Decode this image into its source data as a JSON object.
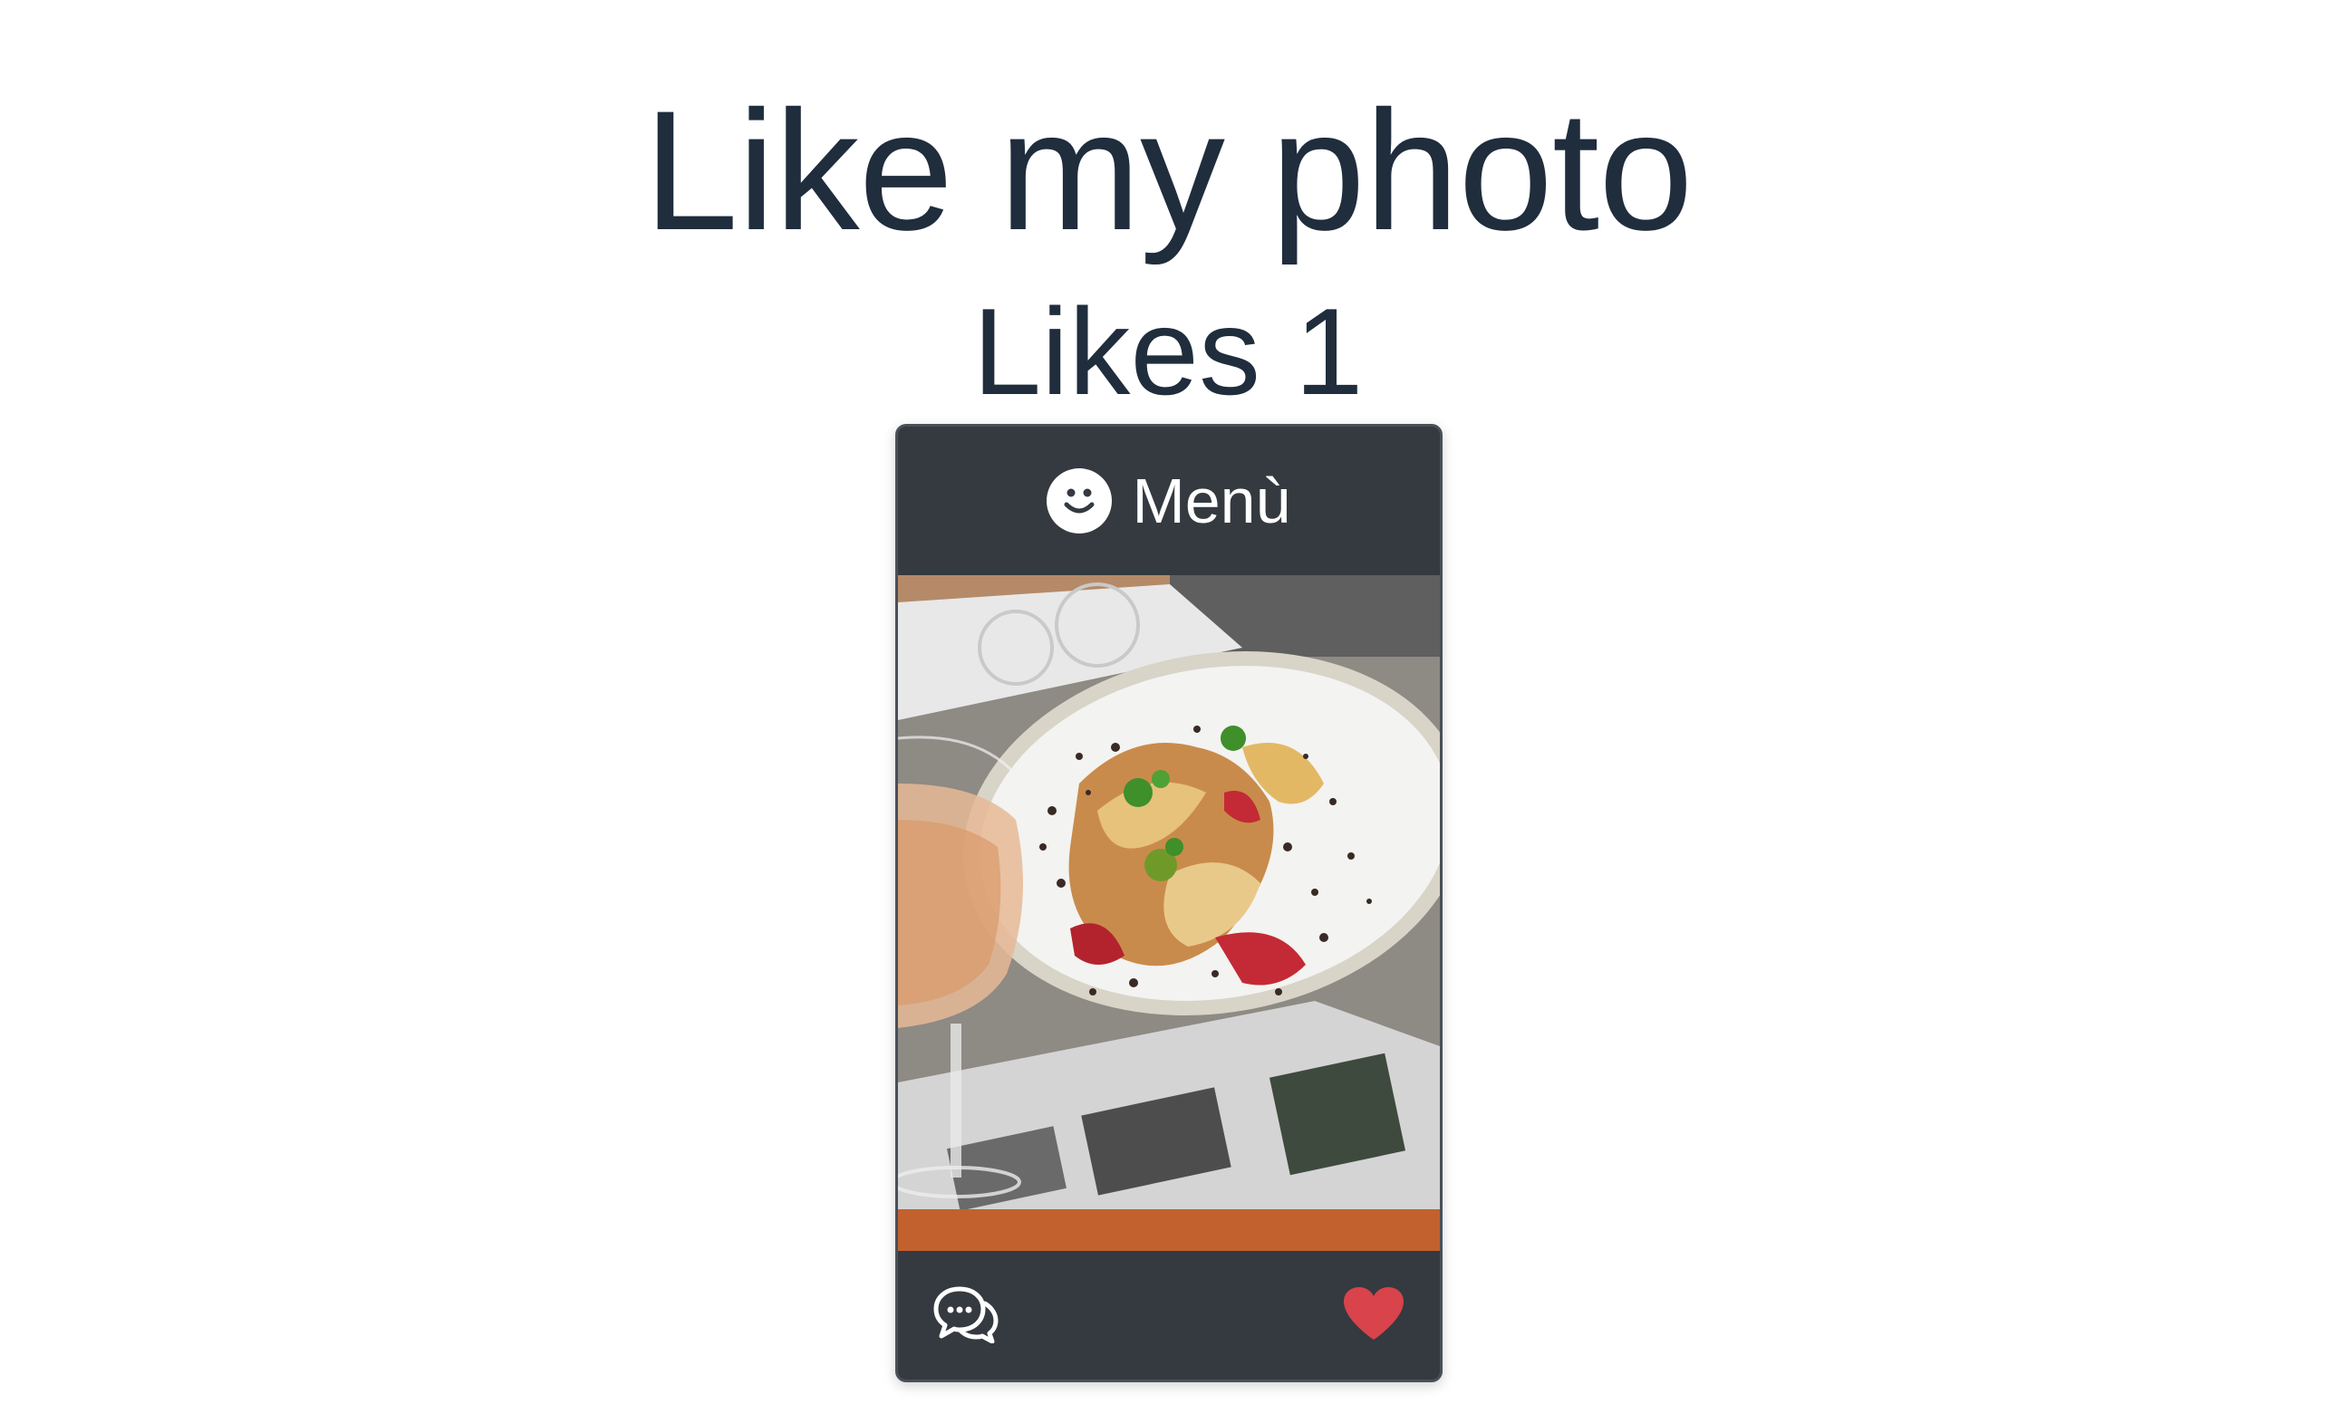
{
  "page": {
    "title": "Like my photo",
    "likes_text": "Likes 1"
  },
  "card": {
    "header": {
      "icon": "smiley-icon",
      "title": "Menù"
    },
    "photo": {
      "alt": "Plate of grilled octopus with a glass of rosé wine"
    },
    "footer": {
      "comment_icon": "chat-bubbles-icon",
      "like_icon": "heart-icon",
      "like_color": "#d9434b"
    }
  },
  "colors": {
    "text": "#1f2d3d",
    "card_bg": "#343a40",
    "heart": "#d9434b"
  }
}
